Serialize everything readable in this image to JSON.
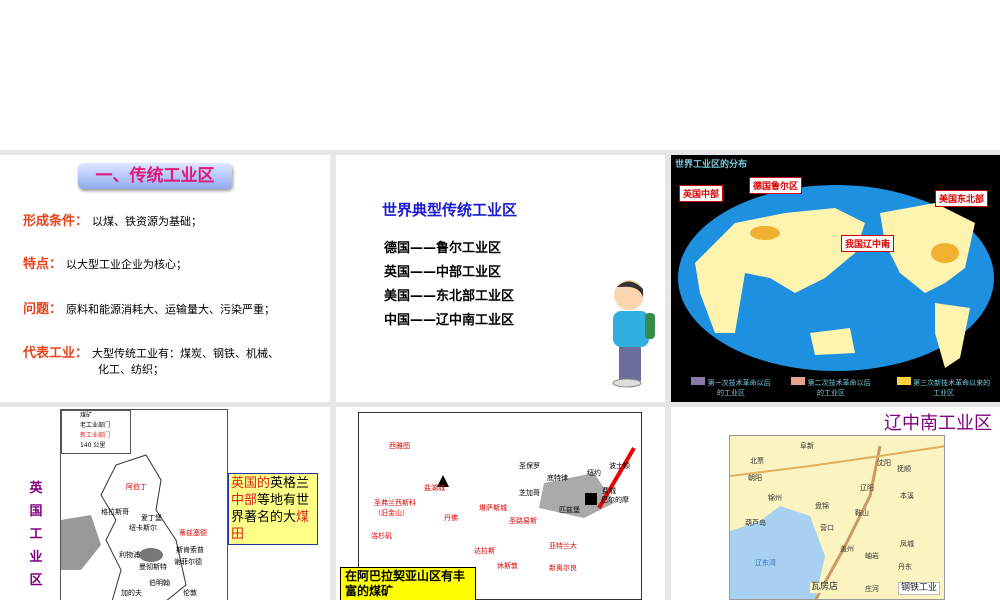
{
  "slide1": {
    "title": "一、传统工业区",
    "rows": [
      {
        "key": "形成条件：",
        "text": "以煤、铁资源为基础；"
      },
      {
        "key": "特点：",
        "text": "以大型工业企业为核心；"
      },
      {
        "key": "问题：",
        "text": "原料和能源消耗大、运输量大、污染严重；"
      },
      {
        "key": "代表工业：",
        "text": "大型传统工业有：煤炭、钢铁、机械、",
        "text2": "化工、纺织；"
      }
    ]
  },
  "slide2": {
    "heading": "世界典型传统工业区",
    "lines": [
      "德国——鲁尔工业区",
      "英国——中部工业区",
      "美国——东北部工业区",
      "中国——辽中南工业区"
    ]
  },
  "slide3": {
    "title": "世界工业区的分布",
    "labels": [
      "英国中部",
      "德国鲁尔区",
      "美国东北部",
      "我国辽中南"
    ],
    "legend": [
      "第一次技术革命以后的工业区",
      "第二次技术革命以后的工业区",
      "第三次新技术革命以来的工业区"
    ],
    "colors": {
      "ocean": "#1e90e0",
      "land": "#fff3b0",
      "industry": "#f0b030"
    }
  },
  "slide4": {
    "vertical_title": "英国工业区",
    "box": {
      "p1": "英国的",
      "p2": "英格兰",
      "p3": "中部",
      "p4": "等地有世界著名的大",
      "p5": "煤田"
    },
    "legend": [
      "煤矿",
      "老工业部门",
      "新工业部门",
      "140 公里"
    ],
    "cities": [
      "阿伯丁",
      "格拉斯哥",
      "爱丁堡",
      "纽卡斯尔",
      "蒂兹塞德",
      "利物浦",
      "曼彻斯特",
      "斯肯索普",
      "谢菲尔德",
      "伯明翰",
      "加的夫",
      "伦敦"
    ]
  },
  "slide5": {
    "box": "在阿巴拉契亚山区有丰富的煤矿",
    "cities": [
      "西雅图",
      "盐湖城",
      "圣弗兰西斯科（旧金山）",
      "丹佛",
      "堪萨斯城",
      "圣路易斯",
      "洛杉矶",
      "达拉斯",
      "休斯敦",
      "新奥尔良",
      "亚特兰大",
      "圣保罗",
      "芝加哥",
      "底特律",
      "匹兹堡",
      "波士顿",
      "纽约",
      "费城",
      "巴尔的摩"
    ]
  },
  "slide6": {
    "title": "辽中南工业区",
    "cities": [
      "阜新",
      "北票",
      "朝阳",
      "锦州",
      "葫芦岛",
      "盘锦",
      "营口",
      "沈阳",
      "抚顺",
      "本溪",
      "辽阳",
      "鞍山",
      "盖州",
      "岫岩",
      "凤城",
      "丹东",
      "庄河",
      "瓦房店"
    ],
    "sea": "辽东湾",
    "legend": "钢铁工业"
  }
}
